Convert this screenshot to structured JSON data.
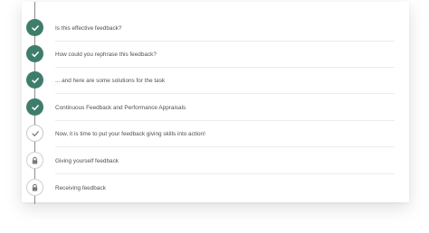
{
  "steps": [
    {
      "label": "Is this effective feedback?",
      "status": "completed",
      "icon": "check-icon"
    },
    {
      "label": "How could you rephrase this feedback?",
      "status": "completed",
      "icon": "check-icon"
    },
    {
      "label": "... and here are some solutions for the task",
      "status": "completed",
      "icon": "check-icon"
    },
    {
      "label": "Continuous Feedback and Performance Appraisals",
      "status": "completed",
      "icon": "check-icon"
    },
    {
      "label": "Now, it is time to put your feedback giving skills into action!",
      "status": "current",
      "icon": "check-icon"
    },
    {
      "label": "Giving yourself feedback",
      "status": "locked",
      "icon": "lock-icon"
    },
    {
      "label": "Receiving feedback",
      "status": "locked",
      "icon": "lock-icon"
    }
  ],
  "colors": {
    "completed": "#3e7d6b",
    "current_check": "#7a7a7a",
    "locked_icon": "#7a7a7a",
    "text": "#505050"
  }
}
